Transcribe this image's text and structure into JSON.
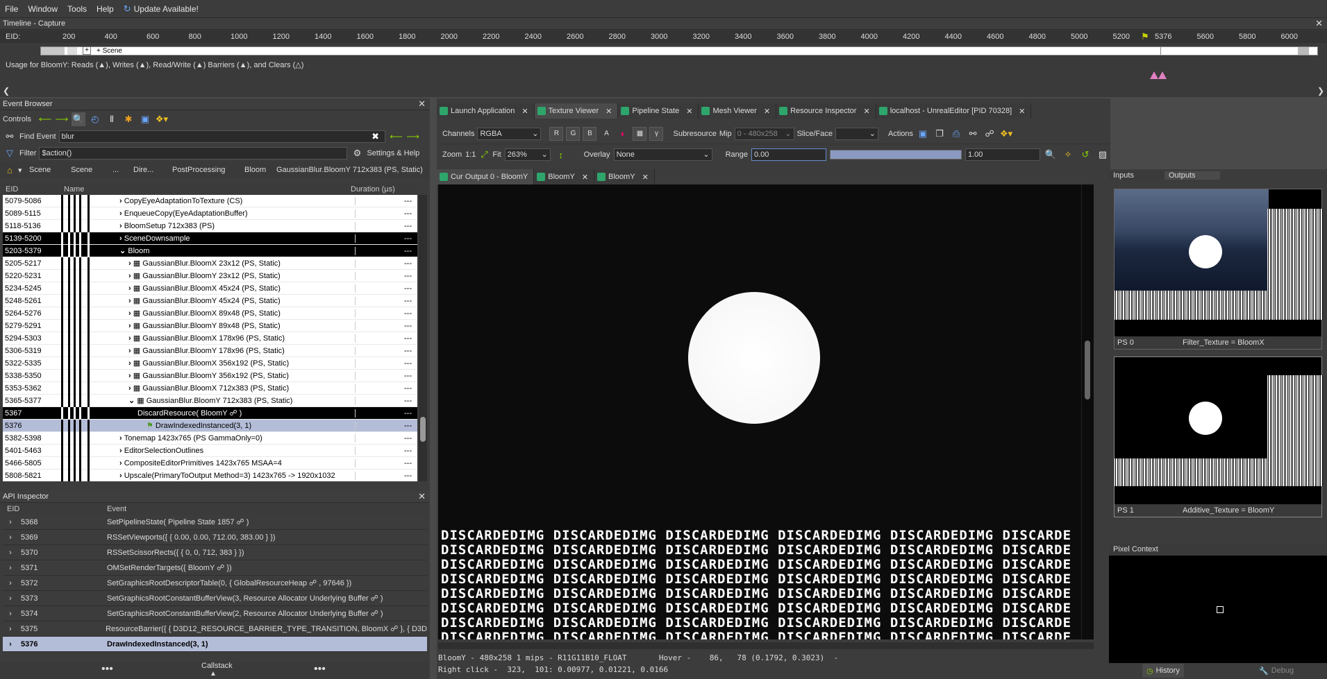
{
  "menu": [
    "File",
    "Window",
    "Tools",
    "Help"
  ],
  "update_label": "Update Available!",
  "timeline": {
    "title": "Timeline - Capture",
    "eid_label": "EID:",
    "ticks": [
      "200",
      "400",
      "600",
      "800",
      "1000",
      "1200",
      "1400",
      "1600",
      "1800",
      "2000",
      "2200",
      "2400",
      "2600",
      "2800",
      "3000",
      "3200",
      "3400",
      "3600",
      "3800",
      "4000",
      "4200",
      "4400",
      "4600",
      "4800",
      "5000",
      "5200",
      "5376",
      "5600",
      "5800",
      "6000"
    ],
    "scene_label": "+ Scene",
    "usage_text": "Usage for BloomY: Reads (▲), Writes (▲), Read/Write (▲) Barriers (▲), and Clears (△)"
  },
  "event_browser": {
    "title": "Event Browser",
    "controls_label": "Controls",
    "find_label": "Find Event",
    "find_value": "blur",
    "filter_label": "Filter",
    "filter_value": "$action()",
    "settings_label": "Settings & Help",
    "breadcrumb": [
      "Scene",
      "Scene",
      "...",
      "Dire...",
      "PostProcessing",
      "Bloom",
      "GaussianBlur.BloomY 712x383 (PS, Static)"
    ],
    "col_eid": "EID",
    "col_name": "Name",
    "col_duration": "Duration (µs)",
    "rows": [
      {
        "eid": "5079-5086",
        "name": "CopyEyeAdaptationToTexture (CS)",
        "dur": "---",
        "style": "",
        "indent": 0,
        "exp": "›"
      },
      {
        "eid": "5089-5115",
        "name": "EnqueueCopy(EyeAdaptationBuffer)",
        "dur": "---",
        "style": "",
        "indent": 0,
        "exp": "›"
      },
      {
        "eid": "5118-5136",
        "name": "BloomSetup 712x383 (PS)",
        "dur": "---",
        "style": "",
        "indent": 0,
        "exp": "›"
      },
      {
        "eid": "5139-5200",
        "name": "SceneDownsample",
        "dur": "---",
        "style": "dark",
        "indent": 0,
        "exp": "›"
      },
      {
        "eid": "5203-5379",
        "name": "Bloom",
        "dur": "---",
        "style": "dark",
        "indent": 0,
        "exp": "⌄"
      },
      {
        "eid": "5205-5217",
        "name": "GaussianBlur.BloomX 23x12 (PS, Static)",
        "dur": "---",
        "style": "",
        "indent": 1,
        "exp": "›"
      },
      {
        "eid": "5220-5231",
        "name": "GaussianBlur.BloomY 23x12 (PS, Static)",
        "dur": "---",
        "style": "",
        "indent": 1,
        "exp": "›"
      },
      {
        "eid": "5234-5245",
        "name": "GaussianBlur.BloomX 45x24 (PS, Static)",
        "dur": "---",
        "style": "",
        "indent": 1,
        "exp": "›"
      },
      {
        "eid": "5248-5261",
        "name": "GaussianBlur.BloomY 45x24 (PS, Static)",
        "dur": "---",
        "style": "",
        "indent": 1,
        "exp": "›"
      },
      {
        "eid": "5264-5276",
        "name": "GaussianBlur.BloomX 89x48 (PS, Static)",
        "dur": "---",
        "style": "",
        "indent": 1,
        "exp": "›"
      },
      {
        "eid": "5279-5291",
        "name": "GaussianBlur.BloomY 89x48 (PS, Static)",
        "dur": "---",
        "style": "",
        "indent": 1,
        "exp": "›"
      },
      {
        "eid": "5294-5303",
        "name": "GaussianBlur.BloomX 178x96 (PS, Static)",
        "dur": "---",
        "style": "",
        "indent": 1,
        "exp": "›"
      },
      {
        "eid": "5306-5319",
        "name": "GaussianBlur.BloomY 178x96 (PS, Static)",
        "dur": "---",
        "style": "",
        "indent": 1,
        "exp": "›"
      },
      {
        "eid": "5322-5335",
        "name": "GaussianBlur.BloomX 356x192 (PS, Static)",
        "dur": "---",
        "style": "",
        "indent": 1,
        "exp": "›"
      },
      {
        "eid": "5338-5350",
        "name": "GaussianBlur.BloomY 356x192 (PS, Static)",
        "dur": "---",
        "style": "",
        "indent": 1,
        "exp": "›"
      },
      {
        "eid": "5353-5362",
        "name": "GaussianBlur.BloomX 712x383 (PS, Static)",
        "dur": "---",
        "style": "",
        "indent": 1,
        "exp": "›"
      },
      {
        "eid": "5365-5377",
        "name": "GaussianBlur.BloomY 712x383 (PS, Static)",
        "dur": "---",
        "style": "",
        "indent": 1,
        "exp": "⌄"
      },
      {
        "eid": "5367",
        "name": "DiscardResource( BloomY ☍ )",
        "dur": "---",
        "style": "dark",
        "indent": 2,
        "exp": ""
      },
      {
        "eid": "5376",
        "name": "DrawIndexedInstanced(3, 1)",
        "dur": "---",
        "style": "sel",
        "indent": 3,
        "exp": ""
      },
      {
        "eid": "5382-5398",
        "name": "Tonemap 1423x765 (PS GammaOnly=0)",
        "dur": "---",
        "style": "",
        "indent": 0,
        "exp": "›"
      },
      {
        "eid": "5401-5463",
        "name": "EditorSelectionOutlines",
        "dur": "---",
        "style": "",
        "indent": 0,
        "exp": "›"
      },
      {
        "eid": "5466-5805",
        "name": "CompositeEditorPrimitives 1423x765 MSAA=4",
        "dur": "---",
        "style": "",
        "indent": 0,
        "exp": "›"
      },
      {
        "eid": "5808-5821",
        "name": "Upscale(PrimaryToOutput Method=3) 1423x765 -> 1920x1032",
        "dur": "---",
        "style": "",
        "indent": 0,
        "exp": "›"
      }
    ]
  },
  "api_inspector": {
    "title": "API Inspector",
    "col_eid": "EID",
    "col_event": "Event",
    "rows": [
      {
        "eid": "5368",
        "event": "SetPipelineState( Pipeline State 1857 ☍ )",
        "sel": false
      },
      {
        "eid": "5369",
        "event": "RSSetViewports({ { 0.00, 0.00, 712.00, 383.00 } })",
        "sel": false
      },
      {
        "eid": "5370",
        "event": "RSSetScissorRects({ { 0, 0, 712, 383 } })",
        "sel": false
      },
      {
        "eid": "5371",
        "event": "OMSetRenderTargets({ BloomY ☍ })",
        "sel": false
      },
      {
        "eid": "5372",
        "event": "SetGraphicsRootDescriptorTable(0, { GlobalResourceHeap ☍ , 97646 })",
        "sel": false
      },
      {
        "eid": "5373",
        "event": "SetGraphicsRootConstantBufferView(3, Resource Allocator Underlying Buffer ☍ )",
        "sel": false
      },
      {
        "eid": "5374",
        "event": "SetGraphicsRootConstantBufferView(2, Resource Allocator Underlying Buffer ☍ )",
        "sel": false
      },
      {
        "eid": "5375",
        "event": "ResourceBarrier({ { D3D12_RESOURCE_BARRIER_TYPE_TRANSITION, BloomX ☍ }, { D3D1",
        "sel": false
      },
      {
        "eid": "5376",
        "event": "DrawIndexedInstanced(3, 1)",
        "sel": true
      }
    ],
    "callstack_label": "Callstack"
  },
  "tabs": [
    {
      "label": "Launch Application",
      "active": false
    },
    {
      "label": "Texture Viewer",
      "active": true
    },
    {
      "label": "Pipeline State",
      "active": false
    },
    {
      "label": "Mesh Viewer",
      "active": false
    },
    {
      "label": "Resource Inspector",
      "active": false
    },
    {
      "label": "localhost - UnrealEditor [PID 70328]",
      "active": false
    }
  ],
  "tex_toolbar": {
    "channels_label": "Channels",
    "channels_value": "RGBA",
    "ch_buttons": [
      "R",
      "G",
      "B",
      "A"
    ],
    "subresource_label": "Subresource",
    "mip_label": "Mip",
    "mip_value": "0 - 480x258",
    "slice_label": "Slice/Face",
    "actions_label": "Actions",
    "zoom_label": "Zoom",
    "zoom_1to1": "1:1",
    "fit_label": "Fit",
    "zoom_value": "263%",
    "overlay_label": "Overlay",
    "overlay_value": "None",
    "range_label": "Range",
    "range_min": "0.00",
    "range_max": "1.00"
  },
  "sub_tabs": [
    {
      "label": "Cur Output 0 - BloomY",
      "closable": false
    },
    {
      "label": "BloomY",
      "closable": true
    },
    {
      "label": "BloomY",
      "closable": true
    }
  ],
  "viewer_text": "DISCARDEDIMG DISCARDEDIMG DISCARDEDIMG DISCARDEDIMG DISCARDEDIMG DISCARDE",
  "status_line1": "BloomY - 480x258 1 mips - R11G11B10_FLOAT       Hover -    86,   78 (0.1792, 0.3023)  -",
  "status_line2": "Right click -  323,  101: 0.00977, 0.01221, 0.0166",
  "right_panel": {
    "tab_inputs": "Inputs",
    "tab_outputs": "Outputs",
    "thumb0_stage": "PS 0",
    "thumb0_label": "Filter_Texture = BloomX",
    "thumb1_stage": "PS 1",
    "thumb1_label": "Additive_Texture = BloomY",
    "pixel_context": "Pixel Context",
    "history_label": "History",
    "debug_label": "Debug"
  },
  "colors": {
    "accent": "#2ea56b",
    "selection": "#b4bdd8",
    "pink": "#e080c0"
  }
}
